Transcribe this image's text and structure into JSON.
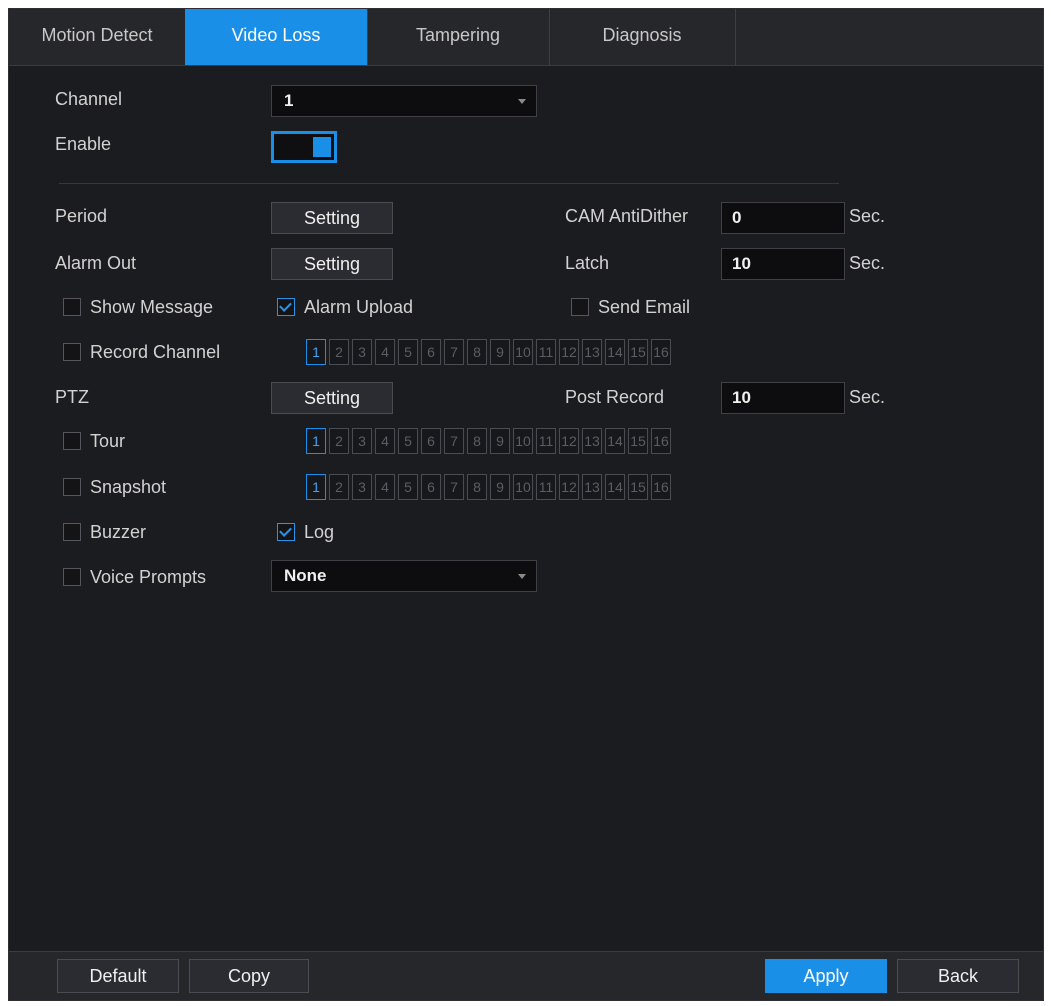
{
  "tabs": [
    {
      "label": "Motion Detect",
      "active": false
    },
    {
      "label": "Video Loss",
      "active": true
    },
    {
      "label": "Tampering",
      "active": false
    },
    {
      "label": "Diagnosis",
      "active": false
    }
  ],
  "form": {
    "channel_label": "Channel",
    "channel_value": "1",
    "enable_label": "Enable",
    "enable_on": true,
    "period_label": "Period",
    "period_button": "Setting",
    "alarm_out_label": "Alarm Out",
    "alarm_out_button": "Setting",
    "cam_antidither_label": "CAM AntiDither",
    "cam_antidither_value": "0",
    "cam_antidither_unit": "Sec.",
    "latch_label": "Latch",
    "latch_value": "10",
    "latch_unit": "Sec.",
    "show_message_label": "Show Message",
    "show_message_checked": false,
    "alarm_upload_label": "Alarm Upload",
    "alarm_upload_checked": true,
    "send_email_label": "Send Email",
    "send_email_checked": false,
    "record_channel_label": "Record Channel",
    "record_channel_checked": false,
    "ptz_label": "PTZ",
    "ptz_button": "Setting",
    "post_record_label": "Post Record",
    "post_record_value": "10",
    "post_record_unit": "Sec.",
    "tour_label": "Tour",
    "tour_checked": false,
    "snapshot_label": "Snapshot",
    "snapshot_checked": false,
    "buzzer_label": "Buzzer",
    "buzzer_checked": false,
    "log_label": "Log",
    "log_checked": true,
    "voice_prompts_label": "Voice Prompts",
    "voice_prompts_checked": false,
    "voice_prompts_value": "None"
  },
  "channels": [
    "1",
    "2",
    "3",
    "4",
    "5",
    "6",
    "7",
    "8",
    "9",
    "10",
    "11",
    "12",
    "13",
    "14",
    "15",
    "16"
  ],
  "selected_channel": "1",
  "footer": {
    "default_label": "Default",
    "copy_label": "Copy",
    "apply_label": "Apply",
    "back_label": "Back"
  },
  "colors": {
    "accent": "#1a8fe8",
    "background": "#1b1c1f"
  }
}
